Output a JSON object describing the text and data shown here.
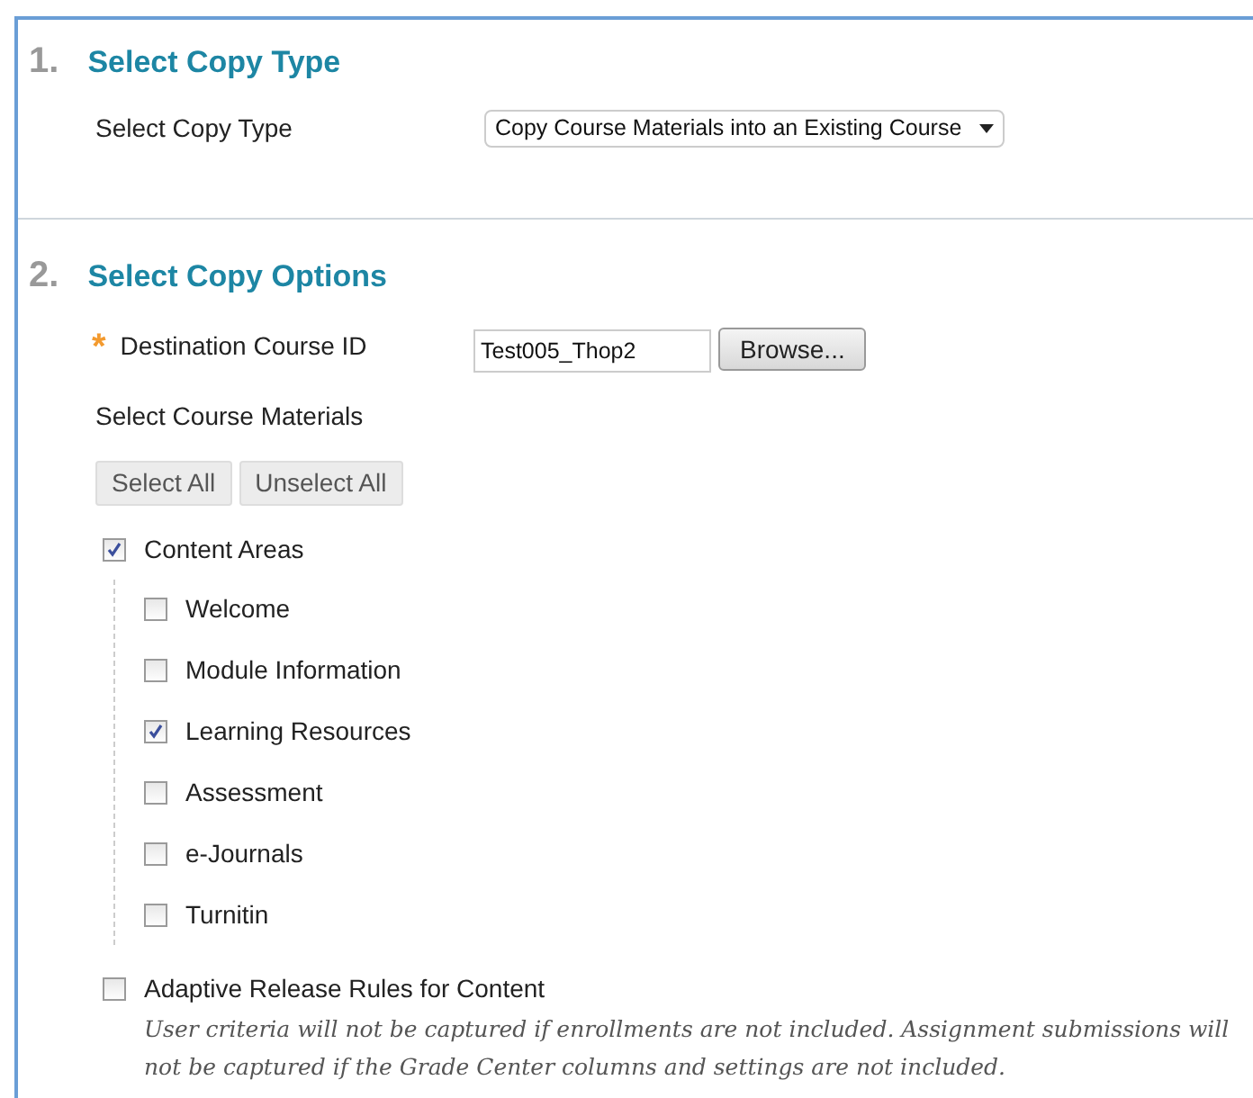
{
  "sections": [
    {
      "number": "1.",
      "title": "Select Copy Type",
      "label": "Select Copy Type",
      "select_value": "Copy Course Materials into an Existing Course"
    },
    {
      "number": "2.",
      "title": "Select Copy Options",
      "required_mark": "*",
      "destination_label": "Destination Course ID",
      "destination_value": "Test005_Thop2",
      "browse_button": "Browse...",
      "materials_label": "Select Course Materials",
      "buttons": [
        "Select All",
        "Unselect All"
      ],
      "materials": [
        {
          "label": "Content Areas",
          "checked": true,
          "children": [
            {
              "label": "Welcome",
              "checked": false
            },
            {
              "label": "Module Information",
              "checked": false
            },
            {
              "label": "Learning Resources",
              "checked": true
            },
            {
              "label": "Assessment",
              "checked": false
            },
            {
              "label": "e-Journals",
              "checked": false
            },
            {
              "label": "Turnitin",
              "checked": false
            }
          ]
        },
        {
          "label": "Adaptive Release Rules for Content",
          "checked": false,
          "note": "User criteria will not be captured if enrollments are not included. Assignment submissions will not be captured if the Grade Center columns and settings are not included."
        }
      ]
    }
  ]
}
